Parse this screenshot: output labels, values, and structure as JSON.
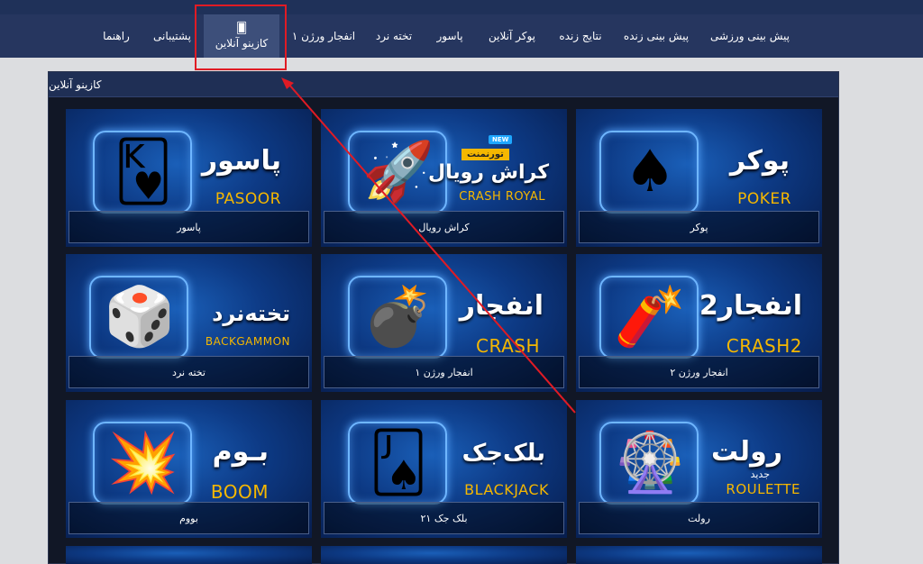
{
  "nav": {
    "items": [
      {
        "label": "پیش بینی ورزشی",
        "name": "nav-sports-prediction"
      },
      {
        "label": "پیش بینی زنده",
        "name": "nav-live-prediction"
      },
      {
        "label": "نتایج زنده",
        "name": "nav-live-results"
      },
      {
        "label": "پوکر آنلاین",
        "name": "nav-online-poker"
      },
      {
        "label": "پاسور",
        "name": "nav-pasoor"
      },
      {
        "label": "تخته نرد",
        "name": "nav-backgammon"
      },
      {
        "label": "انفجار ورژن ۱",
        "name": "nav-crash-v1"
      },
      {
        "label": "کازینو آنلاین",
        "name": "nav-online-casino",
        "active": true,
        "icon": "cards-icon"
      },
      {
        "label": "پشتیبانی",
        "name": "nav-support"
      },
      {
        "label": "راهنما",
        "name": "nav-help"
      }
    ]
  },
  "panel": {
    "title": "کازینو آنلاین"
  },
  "games": [
    {
      "title_fa": "پوکر",
      "title_en": "POKER",
      "caption": "پوکر",
      "icon": "poker-chips-icon",
      "glyph": "🂡"
    },
    {
      "title_fa": "کراش رویال",
      "title_en": "CRASH ROYAL",
      "caption": "کراش رویال",
      "icon": "rocket-icon",
      "glyph": "🚀",
      "badge_new": "NEW",
      "badge_tournament": "تورنمنت"
    },
    {
      "title_fa": "پاسور",
      "title_en": "PASOOR",
      "caption": "پاسور",
      "icon": "playing-cards-icon",
      "glyph": "🂾"
    },
    {
      "title_fa": "انفجار2",
      "title_en": "CRASH2",
      "caption": "انفجار ورژن ۲",
      "icon": "dynamite-icon",
      "glyph": "🧨"
    },
    {
      "title_fa": "انفجار",
      "title_en": "CRASH",
      "caption": "انفجار ورژن ۱",
      "icon": "bomb-icon",
      "glyph": "💣"
    },
    {
      "title_fa": "تخته‌نرد",
      "title_en": "BACKGAMMON",
      "caption": "تخته نرد",
      "icon": "dice-icon",
      "glyph": "🎲"
    },
    {
      "title_fa": "رولت",
      "title_en": "ROULETTE",
      "caption": "رولت",
      "icon": "roulette-wheel-icon",
      "glyph": "🎡",
      "subtitle": "جدید"
    },
    {
      "title_fa": "بلک‌جک",
      "title_en": "BLACKJACK",
      "caption": "بلک جک ۲۱",
      "icon": "blackjack-cards-icon",
      "glyph": "🂫"
    },
    {
      "title_fa": "بـوم",
      "title_en": "BOOM",
      "caption": "بووم",
      "icon": "explosion-icon",
      "glyph": "💥"
    }
  ],
  "colors": {
    "nav_bg": "#26365f",
    "accent_gold": "#f5b700",
    "annotation_red": "#e01b24"
  }
}
